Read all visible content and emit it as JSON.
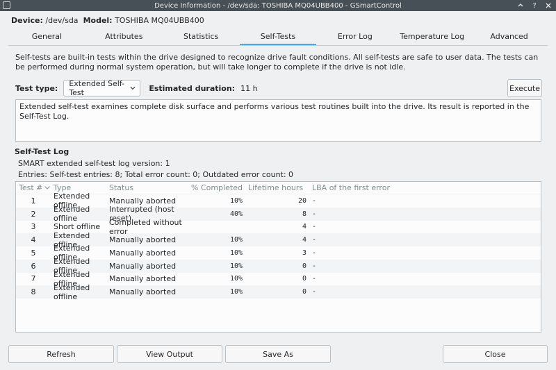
{
  "window": {
    "title": "Device Information - /dev/sda: TOSHIBA MQ04UBB400 - GSmartControl"
  },
  "device": {
    "device_label": "Device:",
    "device_value": "/dev/sda",
    "model_label": "Model:",
    "model_value": "TOSHIBA MQ04UBB400"
  },
  "tabs": [
    {
      "label": "General"
    },
    {
      "label": "Attributes"
    },
    {
      "label": "Statistics"
    },
    {
      "label": "Self-Tests"
    },
    {
      "label": "Error Log"
    },
    {
      "label": "Temperature Log"
    },
    {
      "label": "Advanced"
    }
  ],
  "active_tab": "Self-Tests",
  "selftests": {
    "description": "Self-tests are built-in tests within the drive designed to recognize drive fault conditions. All self-tests are safe to user data. The tests can be performed during normal system operation, but will take longer to complete if the drive is not idle.",
    "test_type_label": "Test type:",
    "test_type_value": "Extended Self-Test",
    "duration_label": "Estimated duration:",
    "duration_value": "11 h",
    "execute_label": "Execute",
    "test_info": "Extended self-test examines complete disk surface and performs various test routines built into the drive. Its result is reported in the Self-Test Log."
  },
  "log": {
    "heading": "Self-Test Log",
    "version_text": "SMART extended self-test log version: 1",
    "entries_text": "Entries: Self-test entries: 8; Total error count: 0; Outdated error count: 0",
    "columns": [
      "Test #",
      "Type",
      "Status",
      "% Completed",
      "Lifetime hours",
      "LBA of the first error"
    ],
    "rows": [
      {
        "num": "1",
        "type": "Extended offline",
        "status": "Manually aborted",
        "pct": "10%",
        "hours": "20",
        "lba": "-"
      },
      {
        "num": "2",
        "type": "Extended offline",
        "status": "Interrupted (host reset)",
        "pct": "40%",
        "hours": "8",
        "lba": "-"
      },
      {
        "num": "3",
        "type": "Short offline",
        "status": "Completed without error",
        "pct": "",
        "hours": "4",
        "lba": "-"
      },
      {
        "num": "4",
        "type": "Extended offline",
        "status": "Manually aborted",
        "pct": "10%",
        "hours": "4",
        "lba": "-"
      },
      {
        "num": "5",
        "type": "Extended offline",
        "status": "Manually aborted",
        "pct": "10%",
        "hours": "3",
        "lba": "-"
      },
      {
        "num": "6",
        "type": "Extended offline",
        "status": "Manually aborted",
        "pct": "10%",
        "hours": "0",
        "lba": "-"
      },
      {
        "num": "7",
        "type": "Extended offline",
        "status": "Manually aborted",
        "pct": "10%",
        "hours": "0",
        "lba": "-"
      },
      {
        "num": "8",
        "type": "Extended offline",
        "status": "Manually aborted",
        "pct": "10%",
        "hours": "0",
        "lba": "-"
      }
    ]
  },
  "buttons": {
    "refresh": "Refresh",
    "view_output": "View Output",
    "save_as": "Save As",
    "close": "Close"
  },
  "colors": {
    "accent": "#3daee9",
    "titlebar": "#475057"
  }
}
